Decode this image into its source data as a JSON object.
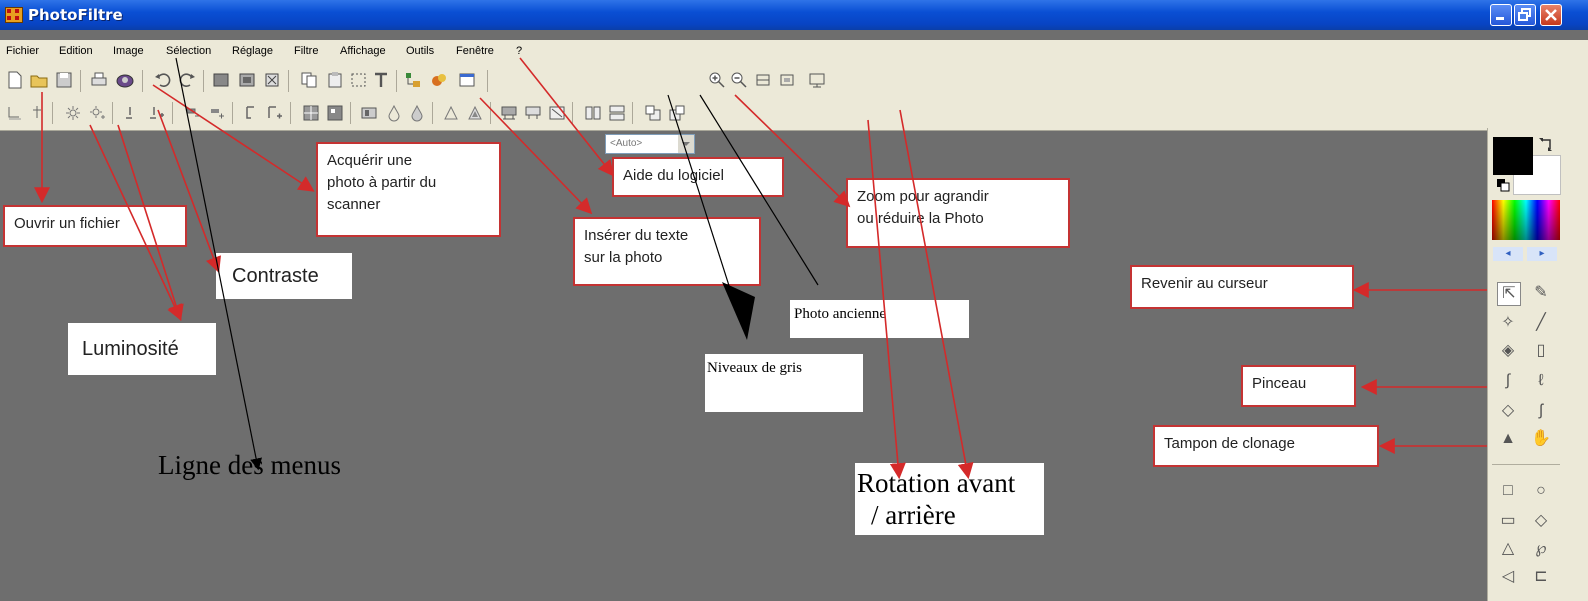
{
  "window": {
    "title": "PhotoFiltre"
  },
  "menu": [
    "Fichier",
    "Edition",
    "Image",
    "Sélection",
    "Réglage",
    "Filtre",
    "Affichage",
    "Outils",
    "Fenêtre",
    "?"
  ],
  "toolbar": {
    "zoom_value": "<Auto>"
  },
  "annotations": {
    "open_file": "Ouvrir un fichier",
    "acquire_line1": "Acquérir une",
    "acquire_line2": "photo à partir du",
    "acquire_line3": "scanner",
    "help": "Aide du logiciel",
    "zoom_line1": "Zoom pour agrandir",
    "zoom_line2": "ou réduire la Photo",
    "insert_text_line1": "Insérer du texte",
    "insert_text_line2": "sur la photo",
    "contrast": "Contraste",
    "brightness": "Luminosité",
    "old_photo": "Photo ancienne",
    "grayscale": "Niveaux de gris",
    "menu_line": "Ligne des menus",
    "rotation_line1": "Rotation avant",
    "rotation_line2": "/ arrière",
    "cursor": "Revenir au curseur",
    "brush": "Pinceau",
    "clone": "Tampon de clonage"
  },
  "colors": {
    "title_bar": "#0a4fd4",
    "arrow_red": "#d42a2a",
    "canvas": "#6e6e6e"
  }
}
